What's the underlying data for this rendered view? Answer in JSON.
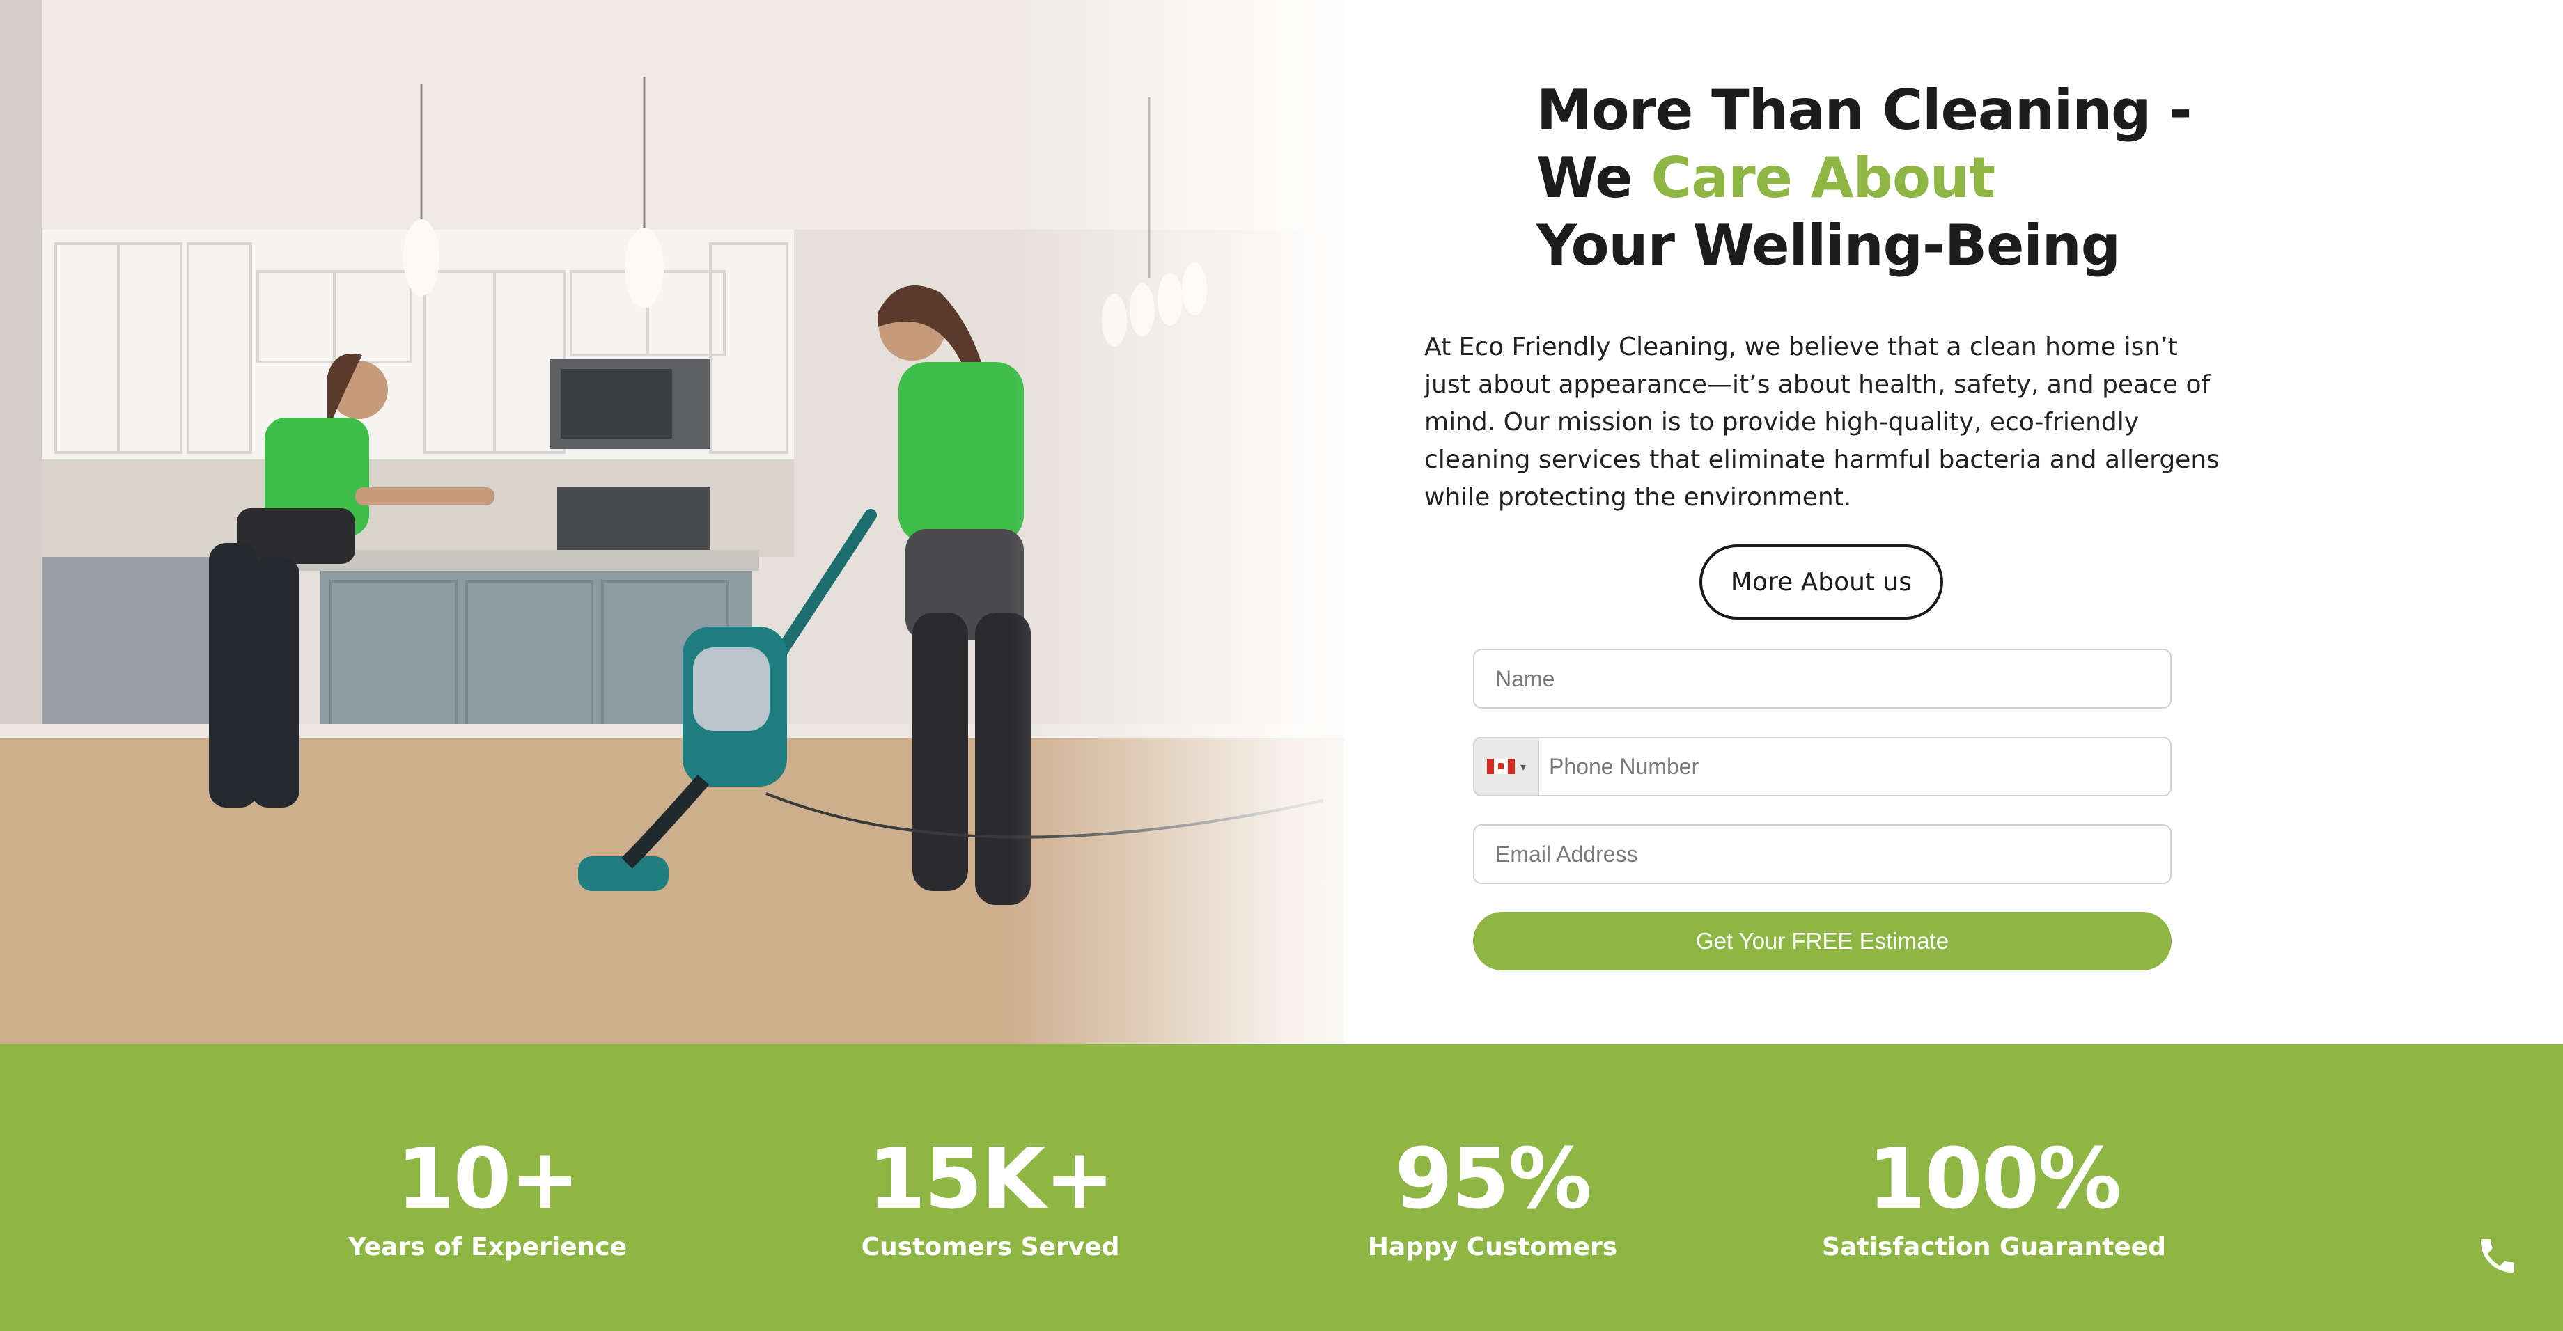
{
  "headline": {
    "line1": "More Than Cleaning -",
    "line2_prefix": "We ",
    "line2_accent": "Care About",
    "line3": "Your Welling-Being"
  },
  "intro": "At Eco Friendly Cleaning, we believe that a clean home isn’t just about appearance—it’s about health, safety, and peace of mind. Our mission is to provide high-quality, eco-friendly cleaning services that eliminate harmful bacteria and allergens while protecting the environment.",
  "more_button": "More About us",
  "form": {
    "name_placeholder": "Name",
    "phone_placeholder": "Phone Number",
    "email_placeholder": "Email Address",
    "country_flag": "canada-flag-icon",
    "submit_label": "Get Your FREE Estimate"
  },
  "stats": [
    {
      "value": "10+",
      "label": "Years of Experience"
    },
    {
      "value": "15K+",
      "label": "Customers Served"
    },
    {
      "value": "95%",
      "label": "Happy Customers"
    },
    {
      "value": "100%",
      "label": "Satisfaction Guaranteed"
    }
  ],
  "colors": {
    "brand_green": "#8db645",
    "heading": "#1c1c1c",
    "text": "#222222"
  },
  "icons": {
    "floating_call": "phone-icon"
  }
}
